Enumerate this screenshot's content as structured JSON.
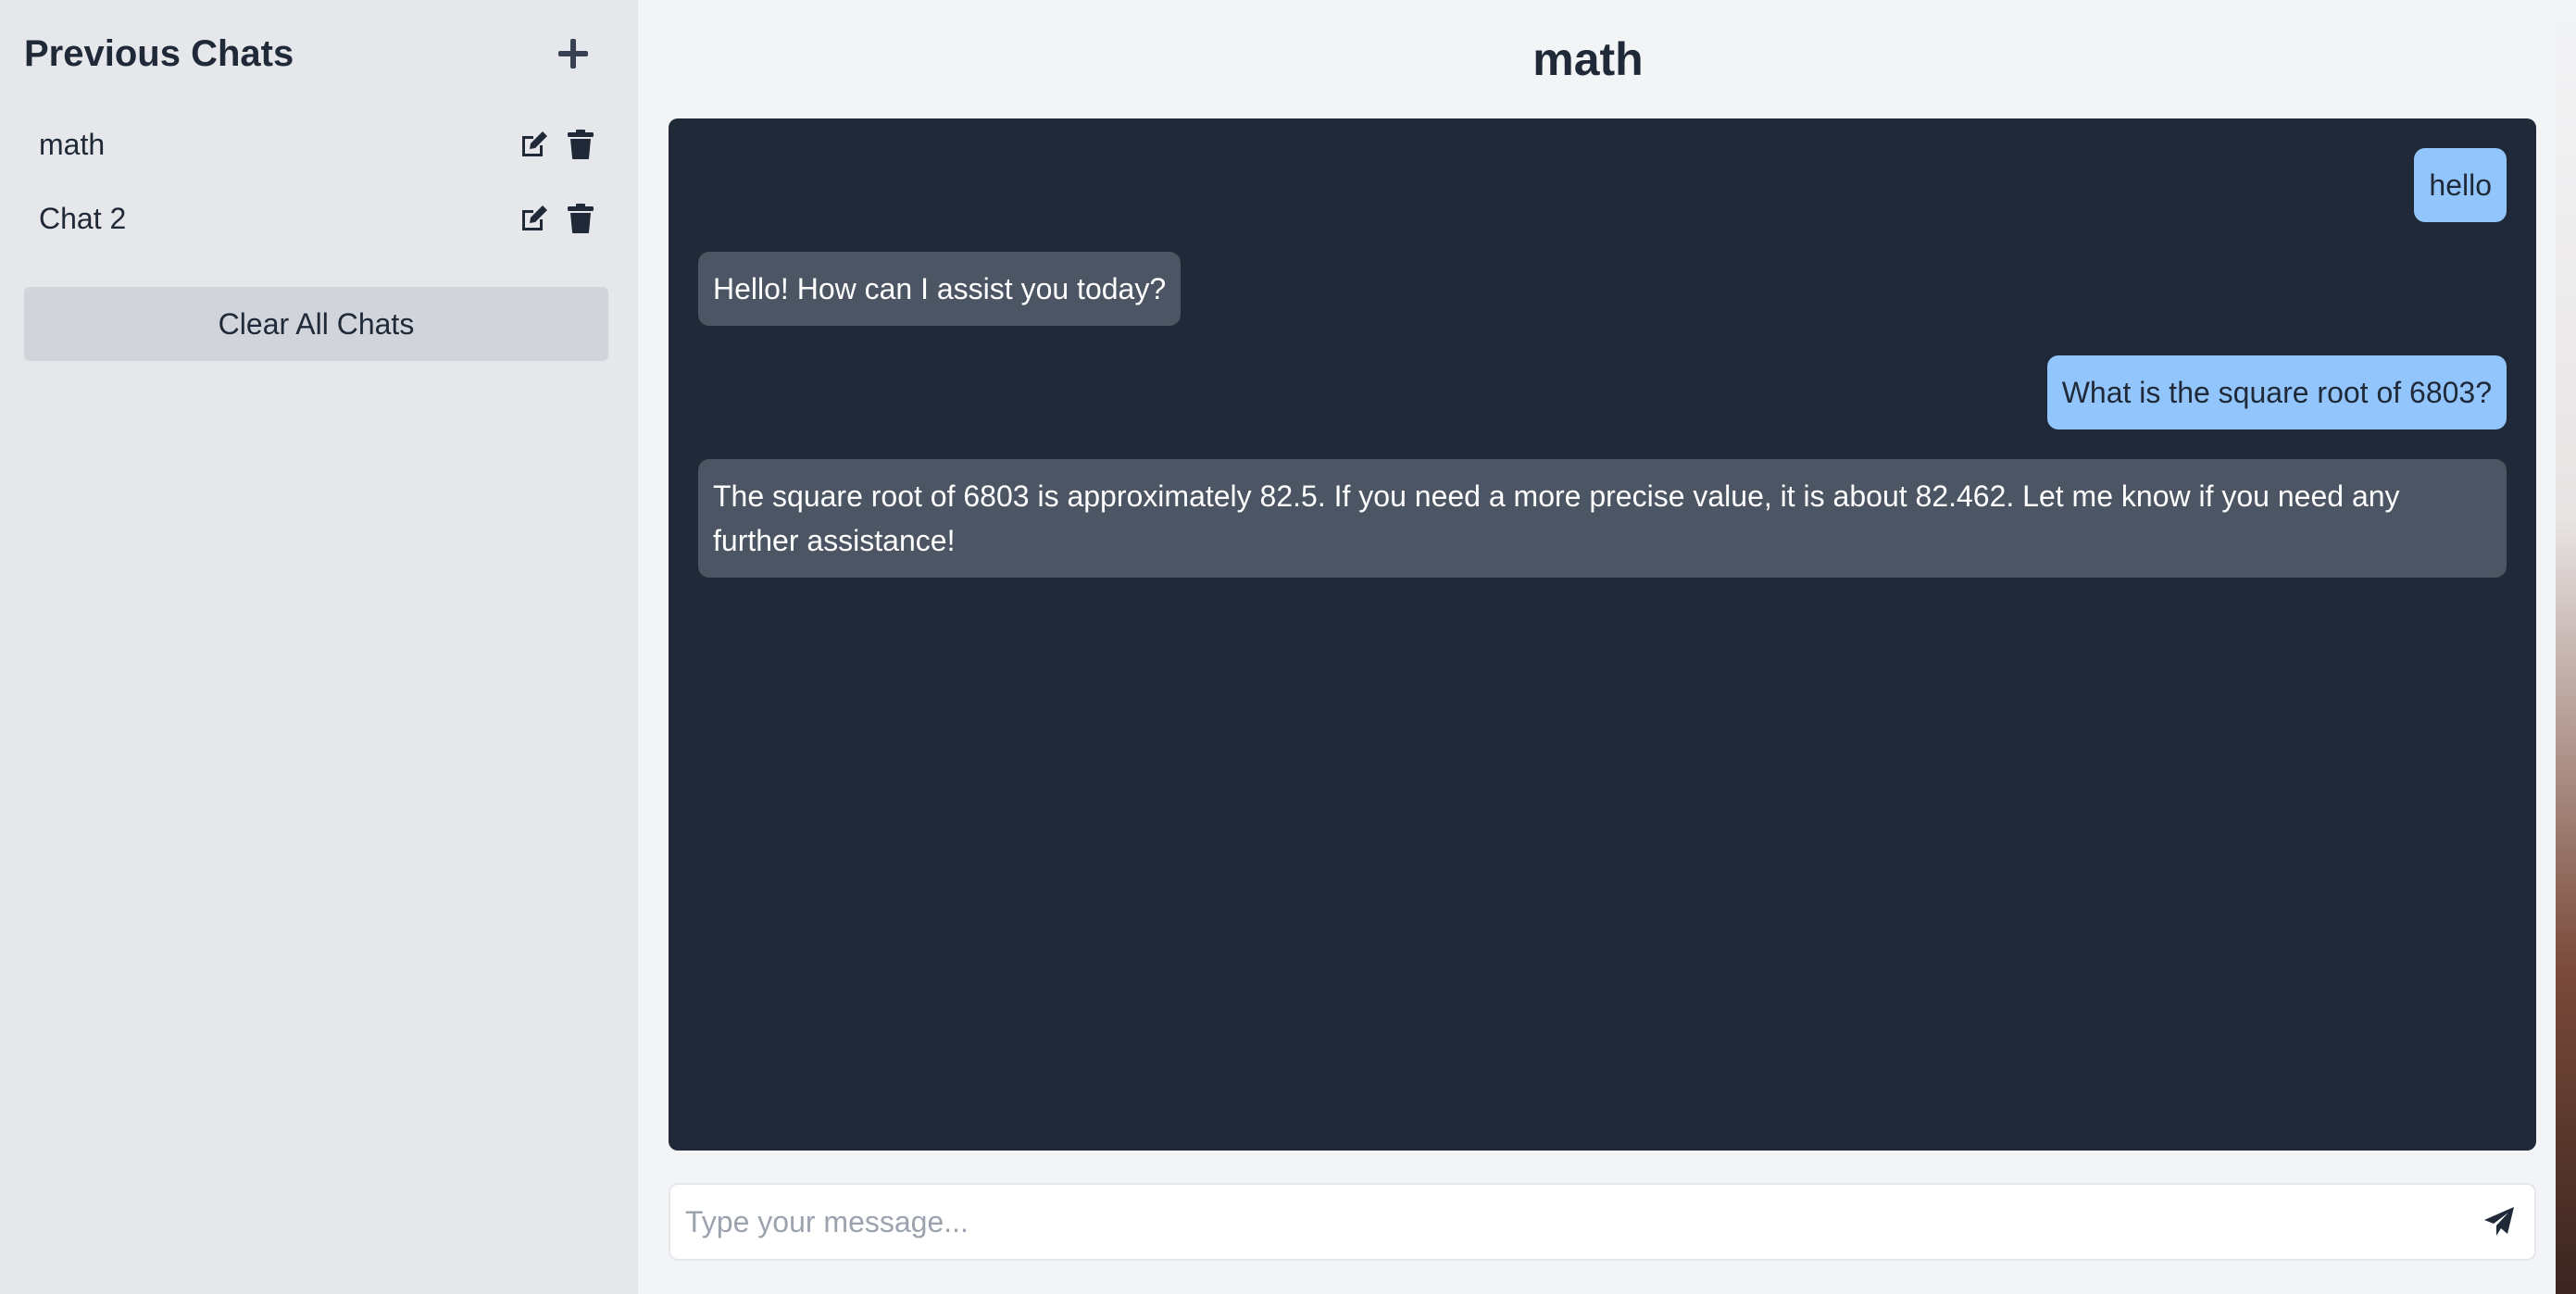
{
  "sidebar": {
    "title": "Previous Chats",
    "new_chat_icon": "plus-icon",
    "chats": [
      {
        "label": "math",
        "edit_icon": "edit-icon",
        "delete_icon": "trash-icon"
      },
      {
        "label": "Chat 2",
        "edit_icon": "edit-icon",
        "delete_icon": "trash-icon"
      }
    ],
    "clear_all_label": "Clear All Chats"
  },
  "main": {
    "title": "math",
    "messages": [
      {
        "role": "user",
        "text": "hello"
      },
      {
        "role": "assistant",
        "text": "Hello! How can I assist you today?"
      },
      {
        "role": "user",
        "text": "What is the square root of 6803?"
      },
      {
        "role": "assistant",
        "text": "The square root of 6803 is approximately 82.5. If you need a more precise value, it is about 82.462. Let me know if you need any further assistance!"
      }
    ],
    "input": {
      "value": "",
      "placeholder": "Type your message..."
    },
    "send_icon": "paper-plane-icon"
  },
  "colors": {
    "sidebar_bg": "#e5e7eb",
    "main_bg": "#f3f4f6",
    "chat_panel_bg": "#1f2937",
    "user_bubble": "#93c5fd",
    "assistant_bubble": "#4b5563",
    "clear_button_bg": "#d1d5db"
  }
}
